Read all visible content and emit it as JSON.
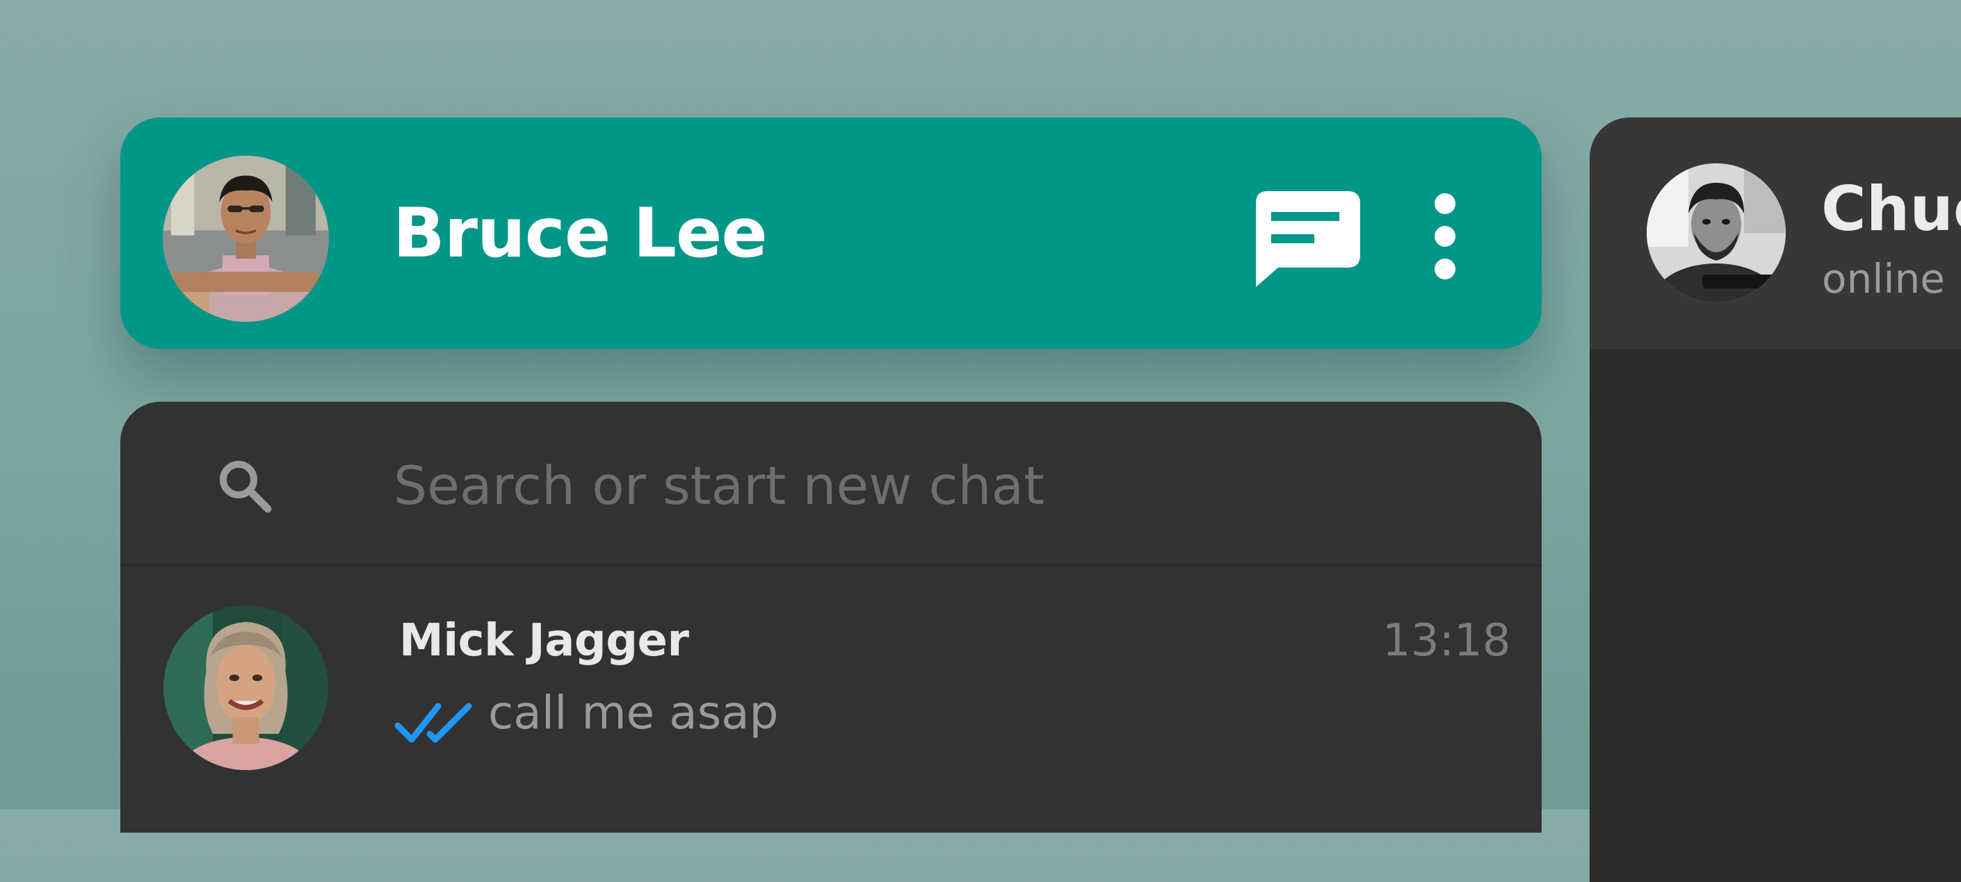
{
  "profile": {
    "name": "Bruce Lee",
    "avatar_alt": "Bruce Lee"
  },
  "header_icons": {
    "new_chat": "new-chat-icon",
    "menu": "more-vertical-icon"
  },
  "search": {
    "placeholder": "Search or start new chat",
    "value": ""
  },
  "chats": [
    {
      "name": "Mick Jagger",
      "time": "13:18",
      "preview": "call me asap",
      "status_icon": "double-check-icon",
      "status_color": "#2196f3"
    }
  ],
  "active_chat": {
    "name": "Chuc",
    "status": "online"
  },
  "colors": {
    "accent": "#009688",
    "panel": "#323232",
    "background": "#7ba7a0",
    "read_receipt": "#2196f3"
  }
}
